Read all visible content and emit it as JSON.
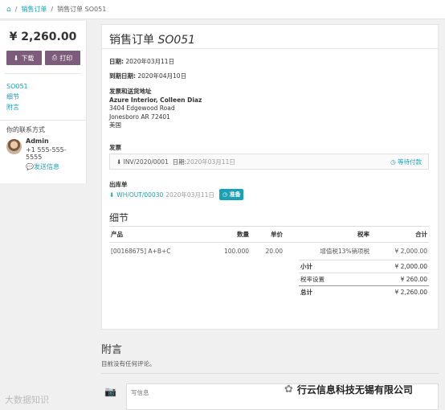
{
  "breadcrumb": {
    "home_icon": "home-icon",
    "sep": "/",
    "item1": "销售订单",
    "item2": "销售订单 SO051"
  },
  "sidebar": {
    "amount": "¥ 2,260.00",
    "download_label": "下载",
    "print_label": "打印",
    "nav": [
      "SO051",
      "细节",
      "附言"
    ],
    "contact_title": "你的联系方式",
    "contact_name": "Admin",
    "contact_phone": "+1 555-555-5555",
    "contact_send": "发送信息"
  },
  "order": {
    "title_prefix": "销售订单",
    "title_num": "SO051",
    "date_label": "日期:",
    "date_value": "2020年03月11日",
    "due_label": "到期日期:",
    "due_value": "2020年04月10日",
    "address_title": "发票和送货地址",
    "address_name": "Azure Interior, Colleen Diaz",
    "address_line1": "3404 Edgewood Road",
    "address_line2": "Jonesboro AR 72401",
    "address_line3": "美国",
    "invoice_title": "发票",
    "invoice_no": "INV/2020/0001",
    "invoice_date_label": "日期:",
    "invoice_date": "2020年03月11日",
    "invoice_status": "等待付款",
    "delivery_title": "出库单",
    "delivery_no": "WH/OUT/00030",
    "delivery_date": "2020年03月11日",
    "delivery_badge": "准备",
    "details_title": "细节"
  },
  "table": {
    "headers": [
      "产品",
      "数量",
      "单价",
      "税率",
      "合计"
    ],
    "rows": [
      [
        "[00168675] A+B+C",
        "100.000",
        "20.00",
        "增值税13%销项税",
        "¥ 2,000.00"
      ]
    ]
  },
  "totals": {
    "subtotal_label": "小计",
    "subtotal": "¥ 2,000.00",
    "tax_label": "税率设置",
    "tax": "¥ 260.00",
    "total_label": "总计",
    "total": "¥ 2,260.00"
  },
  "comments": {
    "title": "附言",
    "empty_text": "目前没有任何评论。",
    "placeholder": "写信息"
  },
  "watermarks": {
    "left": "大数据知识",
    "right": "行云信息科技无锡有限公司"
  }
}
